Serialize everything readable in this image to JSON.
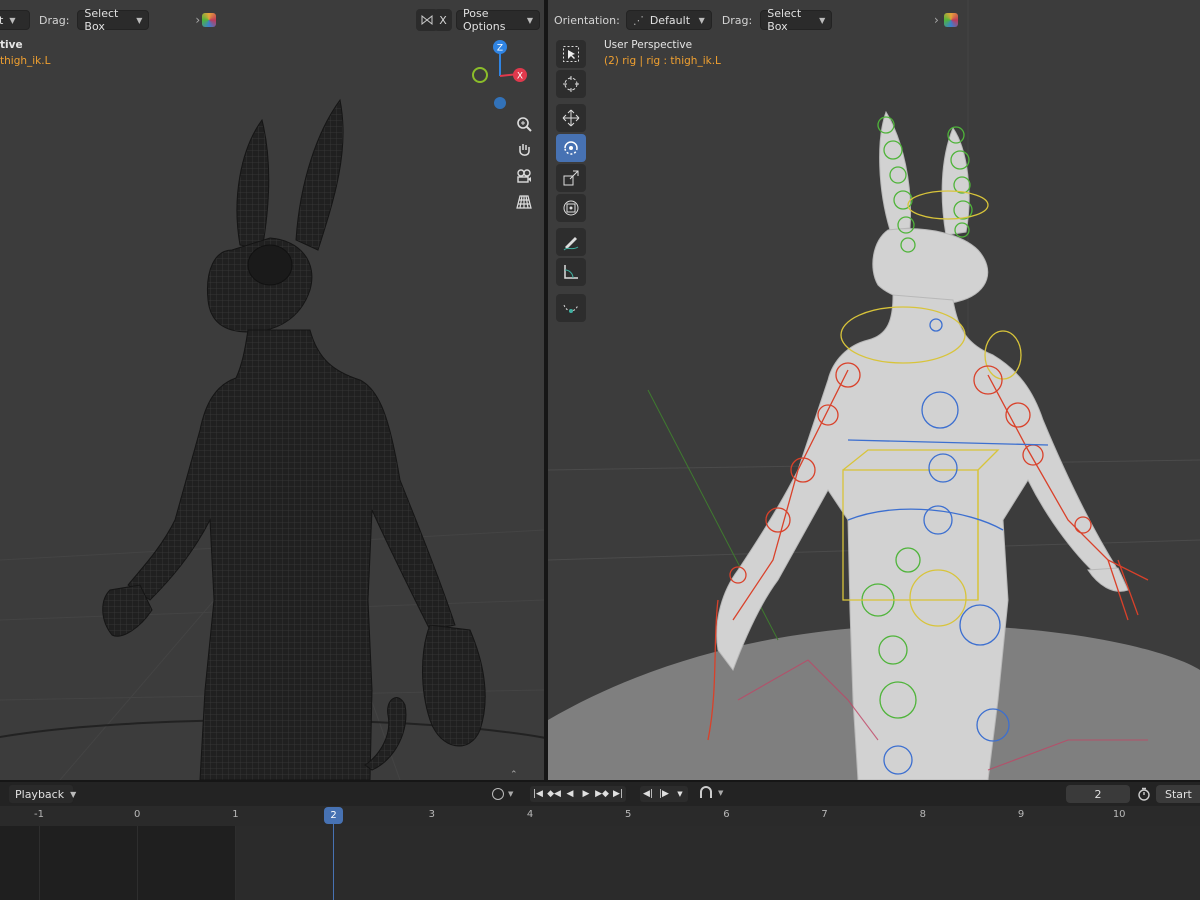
{
  "left_header": {
    "mode_fragment": "t",
    "drag_label": "Drag:",
    "drag_value": "Select Box",
    "x_button": "X",
    "pose_options": "Pose Options"
  },
  "left_overlay": {
    "view_name": "tive",
    "object_text": "thigh_ik.L"
  },
  "right_header": {
    "orientation_label": "Orientation:",
    "orientation_value": "Default",
    "drag_label": "Drag:",
    "drag_value": "Select Box"
  },
  "right_overlay": {
    "view_name": "User Perspective",
    "object_text": "(2) rig | rig : thigh_ik.L"
  },
  "gizmo": {
    "z": "Z",
    "x": "X"
  },
  "timeline": {
    "playback_label": "Playback",
    "current_frame": "2",
    "start_label": "Start",
    "ticks": [
      "-1",
      "0",
      "1",
      "2",
      "3",
      "4",
      "5",
      "6",
      "7",
      "8",
      "9",
      "10"
    ],
    "playhead_frame": "2"
  },
  "colors": {
    "accent_blue": "#4772b3",
    "overlay_orange": "#f0a030",
    "gizmo_x": "#e0394d",
    "gizmo_y": "#8bbd2a",
    "gizmo_z": "#2f84e3",
    "bone_red": "#d9412a",
    "bone_green": "#4fb43a",
    "bone_blue": "#3c6fd0",
    "bone_yellow": "#d8c43a"
  },
  "icons": {
    "tools": [
      "select-box-icon",
      "cursor-icon",
      "move-icon",
      "rotate-icon",
      "scale-icon",
      "transform-icon",
      "annotate-icon",
      "measure-icon",
      "relax-icon"
    ],
    "nav": [
      "zoom-icon",
      "hand-pan-icon",
      "camera-icon",
      "grid-icon"
    ]
  }
}
